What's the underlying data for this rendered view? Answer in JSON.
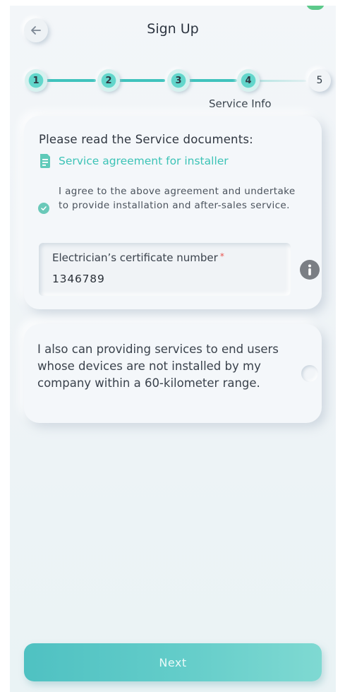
{
  "header": {
    "title": "Sign Up",
    "back_icon": "arrow-left-icon"
  },
  "stepper": {
    "steps": [
      "1",
      "2",
      "3",
      "4",
      "5"
    ],
    "current_step": 4,
    "caption": "Service Info",
    "accent": "#3fc3bd"
  },
  "documents": {
    "heading": "Please read the Service documents:",
    "link_label": "Service agreement for installer",
    "link_icon": "document-icon",
    "agree_text": "I agree to the above agreement and undertake to provide installation and after-sales service.",
    "agree_checked": true
  },
  "certificate": {
    "label": "Electrician’s certificate number",
    "required_mark": "*",
    "value": "1346789",
    "info_icon": "info-icon"
  },
  "service_range": {
    "text": "I also can providing services to end users whose devices are not installed by my company within a 60-kilometer range.",
    "selected": false
  },
  "footer": {
    "next_label": "Next"
  },
  "colors": {
    "accent": "#3cc3b6",
    "required": "#e9544f",
    "button_gradient_start": "#4fc1c2",
    "button_gradient_end": "#7fd9d2"
  }
}
